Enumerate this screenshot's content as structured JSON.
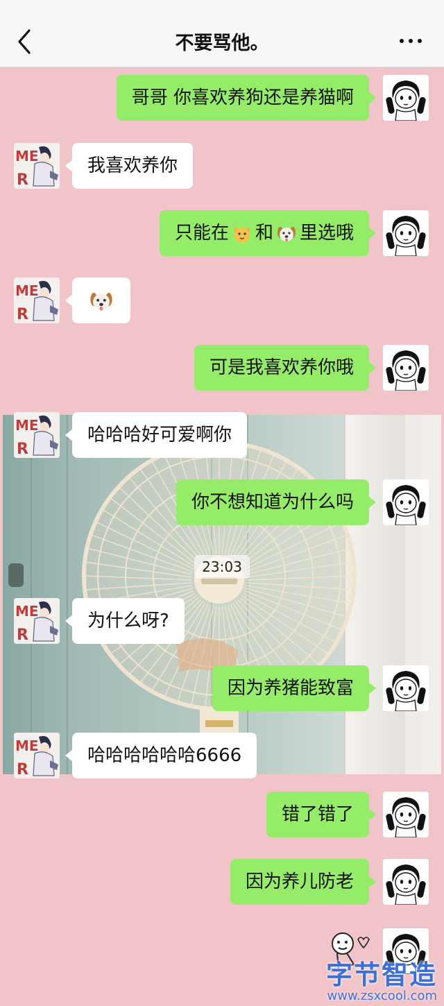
{
  "header": {
    "title": "不要骂他。",
    "back_icon": "chevron-left-icon",
    "more_icon": "more-dots-icon"
  },
  "colors": {
    "chat_background": "#f0c4c8",
    "my_bubble": "#95ec69",
    "their_bubble": "#ffffff"
  },
  "messages": [
    {
      "sender": "me",
      "text": "哥哥 你喜欢养狗还是养猫啊"
    },
    {
      "sender": "them",
      "text": "我喜欢养你"
    },
    {
      "sender": "me",
      "text_before": "只能在",
      "emoji_1": "cat-face-icon",
      "text_middle": "和",
      "emoji_2": "dog-face-icon",
      "text_after": "里选哦"
    },
    {
      "sender": "them",
      "emoji": "dog-face-icon"
    },
    {
      "sender": "me",
      "text": "可是我喜欢养你哦"
    },
    {
      "sender": "them",
      "text": "哈哈哈好可爱啊你"
    },
    {
      "sender": "me",
      "text": "你不想知道为什么吗"
    },
    {
      "sender": "them",
      "text": "为什么呀?"
    },
    {
      "sender": "me",
      "text": "因为养猪能致富"
    },
    {
      "sender": "them",
      "text": "哈哈哈哈哈哈6666"
    },
    {
      "sender": "me",
      "text": "错了错了"
    },
    {
      "sender": "me",
      "text": "因为养儿防老"
    },
    {
      "sender": "me",
      "sticker": "cartoon-sticker-icon"
    }
  ],
  "timestamp": "23:03",
  "watermark": {
    "main": "字节智造",
    "sub": "www.zsxcool.com"
  }
}
